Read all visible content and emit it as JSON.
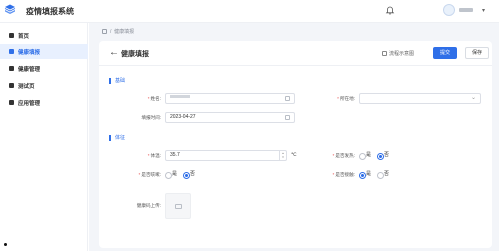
{
  "header": {
    "app_title": "疫情填报系统",
    "brand_color": "#2f6fe8"
  },
  "sidebar": {
    "items": [
      {
        "label": "首页",
        "icon": "home-icon",
        "active": false
      },
      {
        "label": "健康填报",
        "icon": "form-icon",
        "active": true
      },
      {
        "label": "健康管理",
        "icon": "manage-icon",
        "active": false
      },
      {
        "label": "测试页",
        "icon": "test-icon",
        "active": false
      },
      {
        "label": "应用管理",
        "icon": "apps-icon",
        "active": false
      }
    ]
  },
  "breadcrumb": {
    "separator": "/",
    "current": "健康填报"
  },
  "page": {
    "title": "健康填报",
    "flow_link": "流程示意图",
    "submit_label": "提交",
    "save_label": "保存"
  },
  "section1": {
    "title": "基础",
    "name_label": "姓名:",
    "name_value": "",
    "belong_label": "所在地:",
    "belong_value": "",
    "date_label": "填报时间:",
    "date_value": "2023-04-27"
  },
  "section2": {
    "title": "体征",
    "temp_label": "体温:",
    "temp_value": "35.7",
    "temp_unit": "℃",
    "fever_label": "是否发热:",
    "fever_options": [
      "是",
      "否"
    ],
    "fever_selected": "否",
    "cough_label": "是否咳嗽:",
    "cough_options": [
      "是",
      "否"
    ],
    "cough_selected": "否",
    "contact_label": "是否接触:",
    "contact_options": [
      "是",
      "否"
    ],
    "contact_selected": "是",
    "upload_label": "健康码上传:"
  }
}
